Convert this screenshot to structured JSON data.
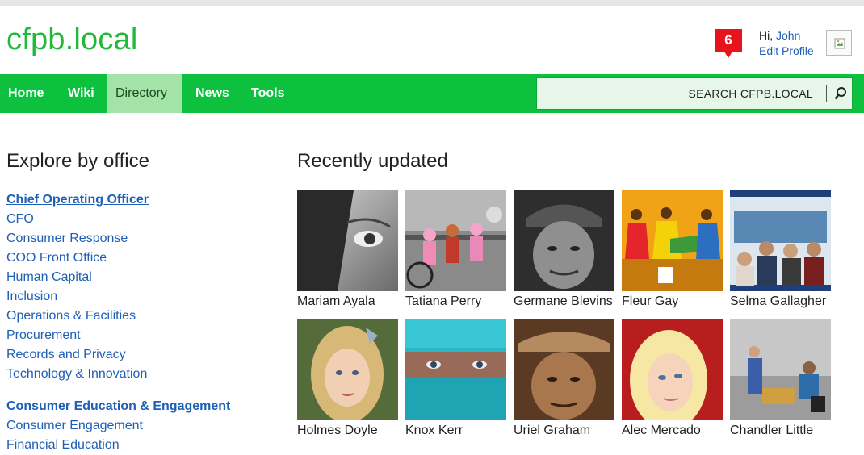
{
  "header": {
    "logo": "cfpb.local",
    "notification_count": "6",
    "greeting": "Hi,",
    "user_name": "John",
    "edit_profile": "Edit Profile"
  },
  "nav": {
    "items": [
      {
        "label": "Home"
      },
      {
        "label": "Wiki"
      },
      {
        "label": "Directory"
      },
      {
        "label": "News"
      },
      {
        "label": "Tools"
      }
    ],
    "active": "Directory",
    "search_label": "SEARCH CFPB.LOCAL"
  },
  "sidebar": {
    "title": "Explore by office",
    "groups": [
      {
        "heading": "Chief Operating Officer",
        "items": [
          "CFO",
          "Consumer Response",
          "COO Front Office",
          "Human Capital",
          "Inclusion",
          "Operations & Facilities",
          "Procurement",
          "Records and Privacy",
          "Technology & Innovation"
        ]
      },
      {
        "heading": "Consumer Education & Engagement",
        "items": [
          "Consumer Engagement",
          "Financial Education"
        ]
      }
    ]
  },
  "recent": {
    "title": "Recently updated",
    "people": [
      {
        "name": "Mariam Ayala"
      },
      {
        "name": "Tatiana Perry"
      },
      {
        "name": "Germane Blevins"
      },
      {
        "name": "Fleur Gay"
      },
      {
        "name": "Selma Gallagher"
      },
      {
        "name": "Holmes Doyle"
      },
      {
        "name": "Knox Kerr"
      },
      {
        "name": "Uriel Graham"
      },
      {
        "name": "Alec Mercado"
      },
      {
        "name": "Chandler Little"
      }
    ]
  },
  "colors": {
    "brand_green": "#0dc13e",
    "logo_green": "#20b93a",
    "active_tab": "#a3e3a8",
    "link_blue": "#1f5fb5",
    "badge_red": "#e8141c"
  }
}
